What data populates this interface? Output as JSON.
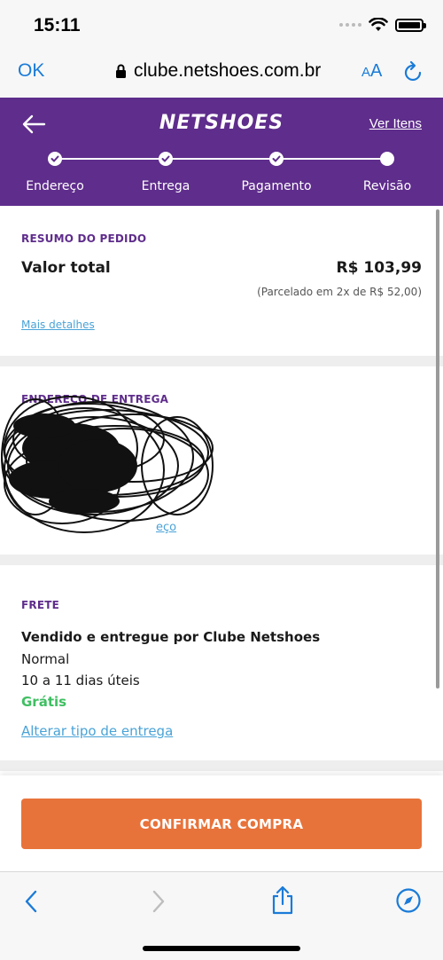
{
  "status_bar": {
    "time": "15:11"
  },
  "browser": {
    "ok_label": "OK",
    "url": "clube.netshoes.com.br",
    "text_size_label_small": "A",
    "text_size_label_large": "A"
  },
  "header": {
    "logo": "NETSHOES",
    "ver_itens": "Ver Itens",
    "steps": [
      {
        "label": "Endereço",
        "status": "completed"
      },
      {
        "label": "Entrega",
        "status": "completed"
      },
      {
        "label": "Pagamento",
        "status": "completed"
      },
      {
        "label": "Revisão",
        "status": "current"
      }
    ]
  },
  "resumo": {
    "title": "RESUMO DO PEDIDO",
    "valor_label": "Valor total",
    "valor_amount": "R$ 103,99",
    "parcelado": "(Parcelado em 2x de R$ 52,00)",
    "mais_detalhes": "Mais detalhes"
  },
  "endereco": {
    "title": "ENDEREÇO DE ENTREGA",
    "link_visible_part": "eço"
  },
  "frete": {
    "title": "FRETE",
    "vendido": "Vendido e entregue por Clube Netshoes",
    "tipo": "Normal",
    "prazo": "10 a 11 dias úteis",
    "preco": "Grátis",
    "alterar": "Alterar tipo de entrega"
  },
  "action": {
    "confirmar": "CONFIRMAR COMPRA"
  },
  "colors": {
    "brand_purple": "#5f2d8c",
    "confirm_orange": "#e8733a",
    "link_blue": "#4aa3d8",
    "free_green": "#3fbf62",
    "ios_blue": "#1a7bd8"
  },
  "icons": [
    "wifi-icon",
    "battery-icon",
    "lock-icon",
    "reload-icon",
    "back-arrow-icon",
    "check-icon",
    "browser-back-icon",
    "browser-forward-icon",
    "share-icon",
    "compass-icon"
  ]
}
